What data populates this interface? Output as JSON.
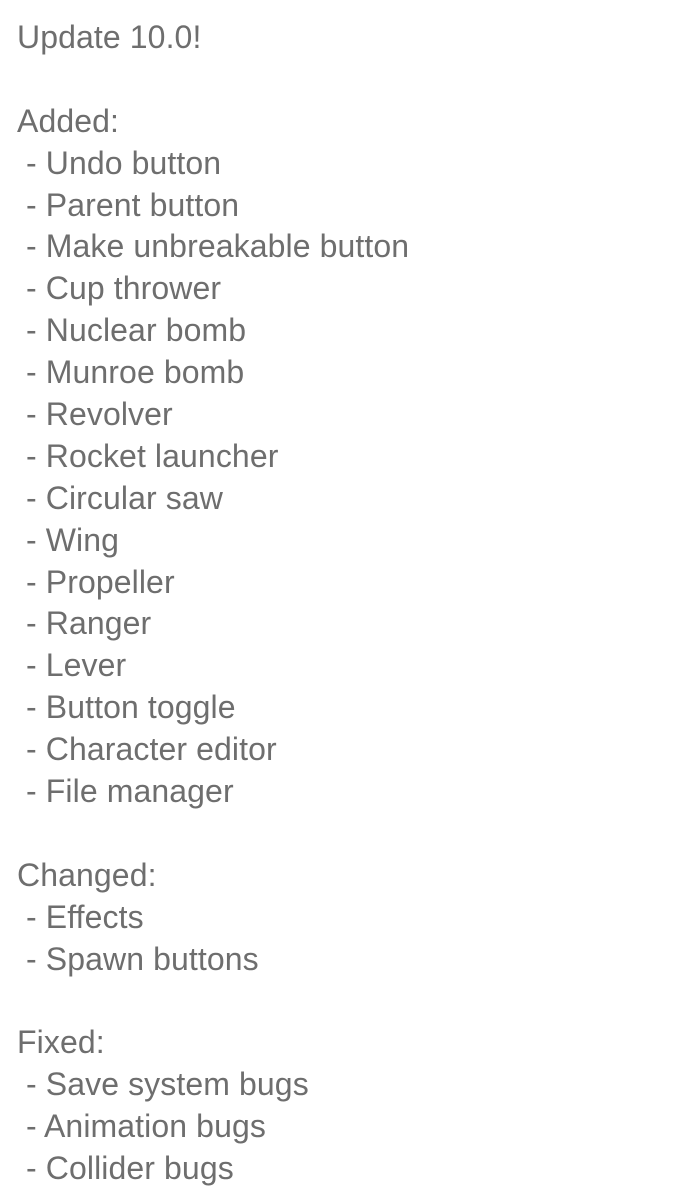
{
  "title": "Update 10.0!",
  "sections": {
    "added": {
      "heading": "Added:",
      "items": [
        "Undo button",
        "Parent button",
        "Make unbreakable button",
        "Cup thrower",
        "Nuclear bomb",
        "Munroe bomb",
        "Revolver",
        "Rocket launcher",
        "Circular saw",
        "Wing",
        "Propeller",
        "Ranger",
        "Lever",
        "Button toggle",
        "Character editor",
        "File manager"
      ]
    },
    "changed": {
      "heading": "Changed:",
      "items": [
        "Effects",
        "Spawn buttons"
      ]
    },
    "fixed": {
      "heading": "Fixed:",
      "items": [
        "Save system bugs",
        "Animation bugs",
        "Collider bugs"
      ]
    }
  },
  "colors": {
    "text": "#6e6e6e",
    "background": "#ffffff"
  }
}
